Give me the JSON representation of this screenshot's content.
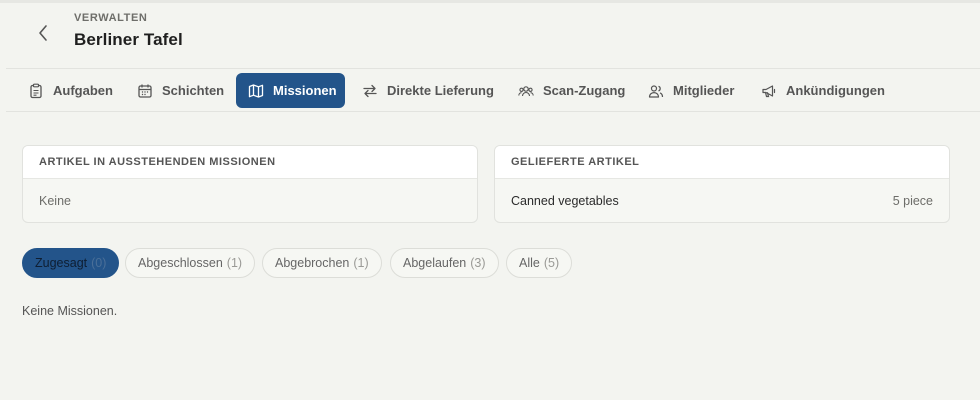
{
  "header": {
    "eyebrow": "VERWALTEN",
    "title": "Berliner Tafel"
  },
  "tabs": [
    {
      "label": "Aufgaben",
      "icon": "clipboard-icon",
      "active": false
    },
    {
      "label": "Schichten",
      "icon": "calendar-icon",
      "active": false
    },
    {
      "label": "Missionen",
      "icon": "map-icon",
      "active": true
    },
    {
      "label": "Direkte Lieferung",
      "icon": "swap-arrows-icon",
      "active": false
    },
    {
      "label": "Scan-Zugang",
      "icon": "group-icon",
      "active": false
    },
    {
      "label": "Mitglieder",
      "icon": "users-icon",
      "active": false
    },
    {
      "label": "Ankündigungen",
      "icon": "megaphone-icon",
      "active": false
    }
  ],
  "pending_card": {
    "heading": "ARTIKEL IN AUSSTEHENDEN MISSIONEN",
    "empty_text": "Keine"
  },
  "delivered_card": {
    "heading": "GELIEFERTE ARTIKEL",
    "items": [
      {
        "name": "Canned vegetables",
        "quantity": "5 piece"
      }
    ]
  },
  "filters": [
    {
      "label": "Zugesagt",
      "count": "(0)",
      "active": true
    },
    {
      "label": "Abgeschlossen",
      "count": "(1)",
      "active": false
    },
    {
      "label": "Abgebrochen",
      "count": "(1)",
      "active": false
    },
    {
      "label": "Abgelaufen",
      "count": "(3)",
      "active": false
    },
    {
      "label": "Alle",
      "count": "(5)",
      "active": false
    }
  ],
  "empty_state": "Keine Missionen.",
  "colors": {
    "accent": "#23548a",
    "background": "#f3f4f0"
  }
}
